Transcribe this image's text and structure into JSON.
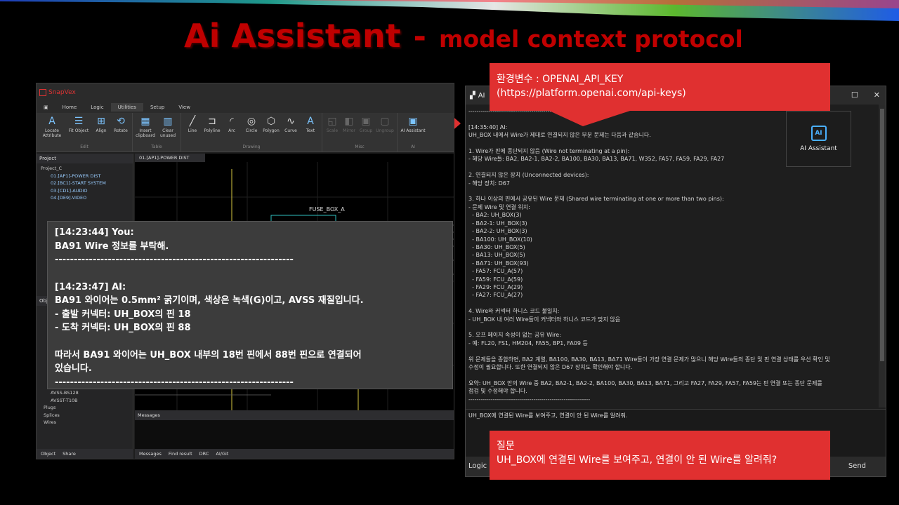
{
  "slide": {
    "title_main": "Ai Assistant",
    "title_sep": "-",
    "title_sub": "model context protocol"
  },
  "app": {
    "name": "SnapVex",
    "menu_tabs": [
      "Home",
      "Logic",
      "Utilities",
      "Setup",
      "View"
    ],
    "ribbon": {
      "edit": {
        "name": "Edit",
        "buttons": [
          "Locate Attribute",
          "Fit Object",
          "Align",
          "Rotate"
        ]
      },
      "table": {
        "name": "Table",
        "buttons": [
          "Insert clipboard",
          "Clear unused"
        ]
      },
      "drawing": {
        "name": "Drawing",
        "buttons": [
          "Line",
          "Polyline",
          "Arc",
          "Circle",
          "Polygon",
          "Curve",
          "Text"
        ]
      },
      "misc": {
        "name": "Misc",
        "buttons": [
          "Scale",
          "Mirror",
          "Group",
          "Ungroup"
        ]
      },
      "ai": {
        "name": "AI",
        "buttons": [
          "AI Assistant"
        ]
      }
    },
    "project_panel": {
      "title": "Project",
      "root": "Project_C",
      "items": [
        "01.[AP1]-POWER DIST",
        "02.[BC1]-START SYSTEM",
        "03.[CD1]-AUDIO",
        "04.[DE9]-VIDEO"
      ]
    },
    "object_panel": {
      "title": "Obj",
      "items": [
        "AVSS-BS128",
        "AVSST-T10B",
        "Plugs",
        "Splices",
        "Wires"
      ]
    },
    "left_tabs": [
      "Object",
      "Share"
    ],
    "doc_tab": "01.[AP1]-POWER DIST",
    "canvas_label": "FUSE_BOX_A",
    "messages_title": "Messages",
    "bottom_tabs": [
      "Messages",
      "Find result",
      "DRC",
      "AI/Git"
    ]
  },
  "overlay_chat": {
    "lines": [
      "[14:23:44] You:",
      "BA91 Wire 정보를 부탁해.",
      "---------------------------------------------------------------",
      "",
      "[14:23:47] AI:",
      "BA91 와이어는 0.5mm² 굵기이며, 색상은 녹색(G)이고, AVSS 재질입니다.",
      "- 출발 커넥터: UH_BOX의 핀 18",
      "- 도착 커넥터: UH_BOX의 핀 88",
      "",
      "따라서 BA91 와이어는 UH_BOX 내부의 18번 핀에서 88번 핀으로 연결되어",
      "있습니다.",
      "---------------------------------------------------------------"
    ]
  },
  "ai_window": {
    "title": "AI",
    "log": [
      "------------------------------------------------------------",
      "",
      "[14:35:40] AI:",
      "UH_BOX 내에서 Wire가 제대로 연결되지 않은 부분 문제는 다음과 같습니다.",
      "",
      "1. Wire가 핀에 종단되지 않음 (Wire not terminating at a pin):",
      "- 해당 Wire들: BA2, BA2-1, BA2-2, BA100, BA30, BA13, BA71, W352, FA57, FA59, FA29, FA27",
      "",
      "2. 연결되지 않은 장치 (Unconnected devices):",
      "- 해당 장치: D67",
      "",
      "3. 하나 이상의 핀에서 공유된 Wire 문제 (Shared wire terminating at one or more than two pins):",
      "- 문제 Wire 및 연결 위치:",
      "  - BA2: UH_BOX(3)",
      "  - BA2-1: UH_BOX(3)",
      "  - BA2-2: UH_BOX(3)",
      "  - BA100: UH_BOX(10)",
      "  - BA30: UH_BOX(5)",
      "  - BA13: UH_BOX(5)",
      "  - BA71: UH_BOX(93)",
      "  - FA57: FCU_A(57)",
      "  - FA59: FCU_A(59)",
      "  - FA29: FCU_A(29)",
      "  - FA27: FCU_A(27)",
      "",
      "4. Wire와 커넥터 하니스 코드 불일치:",
      "- UH_BOX 내 여러 Wire들이 커넥터와 하니스 코드가 맞지 않음",
      "",
      "5. 오프 페이지 속성이 없는 공유 Wire:",
      "- 예: FL20, FS1, HM204, FA55, BP1, FA09 등",
      "",
      "위 문제들을 종합하면, BA2 계열, BA100, BA30, BA13, BA71 Wire들이 가장 연결 문제가 많으니 해당 Wire들의 종단 및 핀 연결 상태를 우선 확인 및",
      "수정이 필요합니다. 또한 연결되지 않은 D67 장치도 확인해야 합니다.",
      "",
      "요약: UH_BOX 안의 Wire 중 BA2, BA2-1, BA2-2, BA100, BA30, BA13, BA71, 그리고 FA27, FA29, FA57, FA59는 핀 연결 또는 종단 문제를",
      "점검 및 수정해야 합니다.",
      "------------------------------------------------------------"
    ],
    "input_value": "UH_BOX에 연결된 Wire를 보여주고, 연결이 안 된 Wire를 알려줘.",
    "footer_left": "Logic",
    "send_label": "Send"
  },
  "ai_button": {
    "label": "AI Assistant",
    "chip": "AI"
  },
  "callouts": {
    "top_line1": "환경변수 : OPENAI_API_KEY",
    "top_line2": "(https://platform.openai.com/api-keys)",
    "bottom_line1": "질문",
    "bottom_line2": "UH_BOX에 연결된 Wire를 보여주고, 연결이 안 된 Wire를 알려줘?"
  }
}
